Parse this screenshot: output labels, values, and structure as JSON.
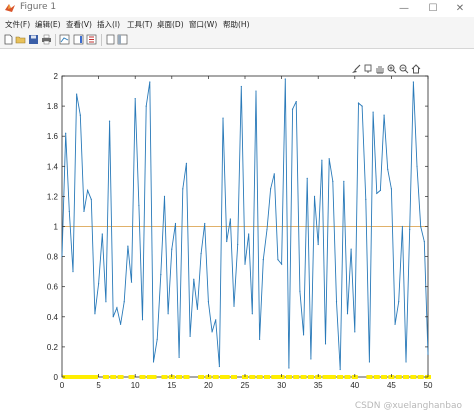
{
  "window": {
    "title": "Figure 1",
    "minimize_glyph": "—",
    "maximize_glyph": "☐",
    "close_glyph": "✕"
  },
  "menu": [
    "文件(F)",
    "编辑(E)",
    "查看(V)",
    "插入(I)",
    "工具(T)",
    "桌面(D)",
    "窗口(W)",
    "帮助(H)"
  ],
  "toolbar_icons": [
    "new-figure-icon",
    "open-file-icon",
    "save-icon",
    "print-icon",
    "link-plot-icon",
    "insert-colorbar-icon",
    "insert-legend-icon"
  ],
  "axes_toolbar_icons": [
    "brush-icon",
    "data-tips-icon",
    "pan-icon",
    "zoom-in-icon",
    "zoom-out-icon",
    "home-icon"
  ],
  "watermark": "CSDN @xuelanghanbao",
  "colors": {
    "series": "#2a7ab9",
    "reference": "#e0b16a",
    "markers": "#ffee00"
  },
  "chart_data": {
    "type": "line",
    "xlim": [
      0,
      50
    ],
    "ylim": [
      0,
      2
    ],
    "xticks": [
      0,
      5,
      10,
      15,
      20,
      25,
      30,
      35,
      40,
      45,
      50
    ],
    "yticks": [
      0,
      0.2,
      0.4,
      0.6,
      0.8,
      1,
      1.2,
      1.4,
      1.6,
      1.8,
      2
    ],
    "xtick_labels": [
      "0",
      "5",
      "10",
      "15",
      "20",
      "25",
      "30",
      "35",
      "40",
      "45",
      "50"
    ],
    "ytick_labels": [
      "0",
      "0.2",
      "0.4",
      "0.6",
      "0.8",
      "1",
      "1.2",
      "1.4",
      "1.6",
      "1.8",
      "2"
    ],
    "grid": false,
    "reference_line": {
      "y": 1
    },
    "series": [
      {
        "x": [
          0,
          0.5,
          1,
          1.5,
          2,
          2.5,
          3,
          3.5,
          4,
          4.5,
          5,
          5.5,
          6,
          6.5,
          7,
          7.5,
          8,
          8.5,
          9,
          9.5,
          10,
          10.5,
          11,
          11.5,
          12,
          12.5,
          13,
          13.5,
          14,
          14.5,
          15,
          15.5,
          16,
          16.5,
          17,
          17.5,
          18,
          18.5,
          19,
          19.5,
          20,
          20.5,
          21,
          21.5,
          22,
          22.5,
          23,
          23.5,
          24,
          24.5,
          25,
          25.5,
          26,
          26.5,
          27,
          27.5,
          28,
          28.5,
          29,
          29.5,
          30,
          30.5,
          31,
          31.5,
          32,
          32.5,
          33,
          33.5,
          34,
          34.5,
          35,
          35.5,
          36,
          36.5,
          37,
          37.5,
          38,
          38.5,
          39,
          39.5,
          40,
          40.5,
          41,
          41.5,
          42,
          42.5,
          43,
          43.5,
          44,
          44.5,
          45,
          45.5,
          46,
          46.5,
          47,
          47.5,
          48,
          48.5,
          49,
          49.5,
          50
        ],
        "values": [
          0.8,
          1.62,
          1.1,
          0.7,
          1.88,
          1.74,
          1.1,
          1.24,
          1.18,
          0.42,
          0.62,
          0.95,
          0.5,
          1.7,
          0.4,
          0.46,
          0.35,
          0.5,
          0.87,
          0.63,
          1.85,
          1.14,
          0.38,
          1.8,
          1.96,
          0.1,
          0.25,
          0.68,
          1.2,
          0.42,
          0.85,
          1.02,
          0.13,
          1.25,
          1.42,
          0.27,
          0.65,
          0.45,
          0.82,
          1.02,
          0.5,
          0.3,
          0.38,
          0.07,
          1.72,
          0.9,
          1.05,
          0.47,
          0.88,
          1.93,
          0.75,
          0.95,
          0.42,
          1.9,
          0.25,
          0.78,
          0.98,
          1.25,
          1.35,
          0.78,
          0.75,
          1.98,
          0.06,
          1.78,
          1.83,
          0.57,
          0.28,
          1.32,
          0.12,
          1.2,
          0.88,
          1.44,
          0.22,
          1.45,
          1.3,
          0.5,
          0.05,
          1.3,
          0.42,
          0.85,
          0.3,
          1.82,
          1.8,
          1.18,
          0.1,
          1.76,
          1.22,
          1.24,
          1.74,
          1.38,
          1.25,
          0.35,
          0.5,
          1.0,
          0.1,
          0.98,
          1.96,
          1.4,
          1.0,
          0.9,
          0.15
        ]
      }
    ],
    "marker_series": {
      "y": 0,
      "x": [
        0.5,
        1,
        1.5,
        2,
        2.5,
        3,
        3.5,
        4,
        4.5,
        6,
        7,
        8,
        9.5,
        11,
        12,
        12.5,
        14,
        15,
        16,
        17,
        19,
        20,
        21,
        22,
        22.5,
        23.5,
        25,
        26,
        27,
        28,
        29,
        29.5,
        30,
        31,
        32,
        33,
        34,
        35,
        36,
        36.5,
        37,
        38,
        39,
        40,
        42,
        43,
        44,
        45,
        46,
        47,
        48,
        49,
        50
      ]
    }
  }
}
